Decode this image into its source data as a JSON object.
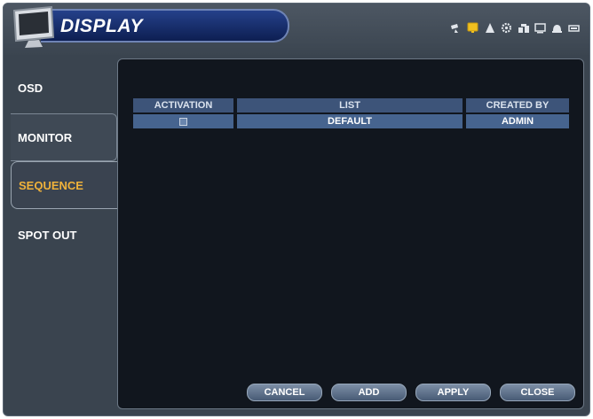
{
  "header": {
    "title": "DISPLAY",
    "icons": [
      "camera-icon",
      "display-icon",
      "alarm-icon",
      "gear-icon",
      "network-icon",
      "storage-icon",
      "user-icon",
      "record-icon"
    ],
    "accent_color": "#f0c020"
  },
  "sidebar": {
    "items": [
      {
        "label": "OSD"
      },
      {
        "label": "MONITOR"
      },
      {
        "label": "SEQUENCE"
      },
      {
        "label": "SPOT OUT"
      }
    ],
    "active_color": "#f0b23a"
  },
  "table": {
    "columns": [
      "ACTIVATION",
      "LIST",
      "CREATED BY"
    ],
    "rows": [
      {
        "activation": true,
        "list": "DEFAULT",
        "created_by": "ADMIN"
      }
    ]
  },
  "buttons": {
    "cancel": "CANCEL",
    "add": "ADD",
    "apply": "APPLY",
    "close": "CLOSE"
  }
}
